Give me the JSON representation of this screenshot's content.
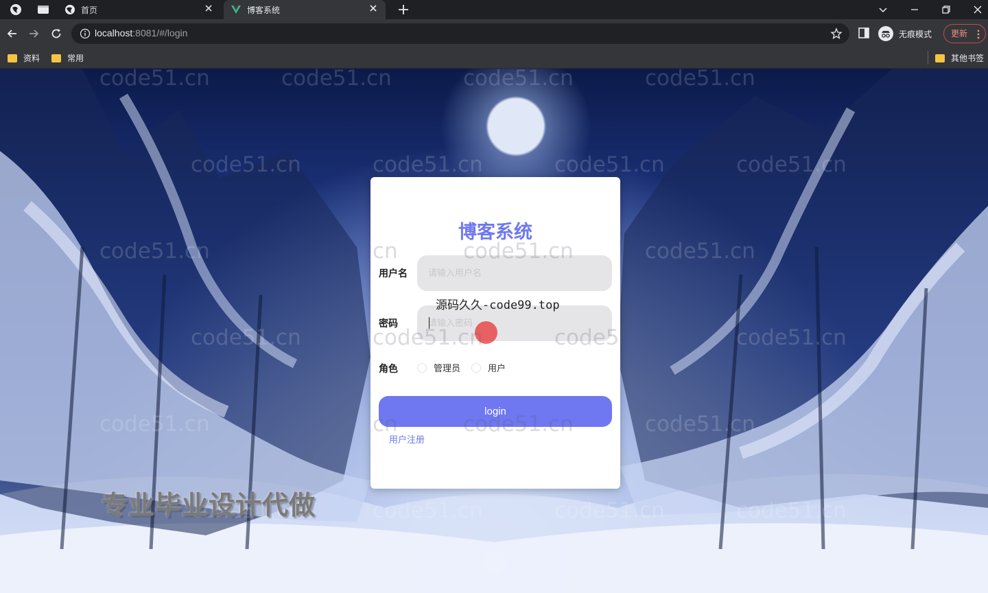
{
  "browser": {
    "tabs": [
      {
        "title": "首页"
      },
      {
        "title": "博客系统"
      }
    ],
    "url": {
      "host": "localhost",
      "rest": ":8081/#/login"
    },
    "incognito_label": "无痕模式",
    "update_label": "更新",
    "bookmarks": [
      {
        "label": "资料"
      },
      {
        "label": "常用"
      }
    ],
    "other_bookmarks": "其他书签"
  },
  "login": {
    "title": "博客系统",
    "username_label": "用户名",
    "username_placeholder": "请输入用户名",
    "password_label": "密码",
    "password_placeholder": "请输入密码",
    "role_label": "角色",
    "roles": [
      "管理员",
      "用户"
    ],
    "login_button": "login",
    "register_link": "用户注册"
  },
  "overlay": {
    "source_text": "源码久久-code99.top",
    "watermark": "code51.cn",
    "watermark_short": "cn",
    "watermark_partial_1": "code5",
    "promo": "专业毕业设计代做"
  },
  "colors": {
    "accent": "#6f78f0",
    "card_bg": "#ffffff",
    "input_bg": "#e5e5e7"
  }
}
